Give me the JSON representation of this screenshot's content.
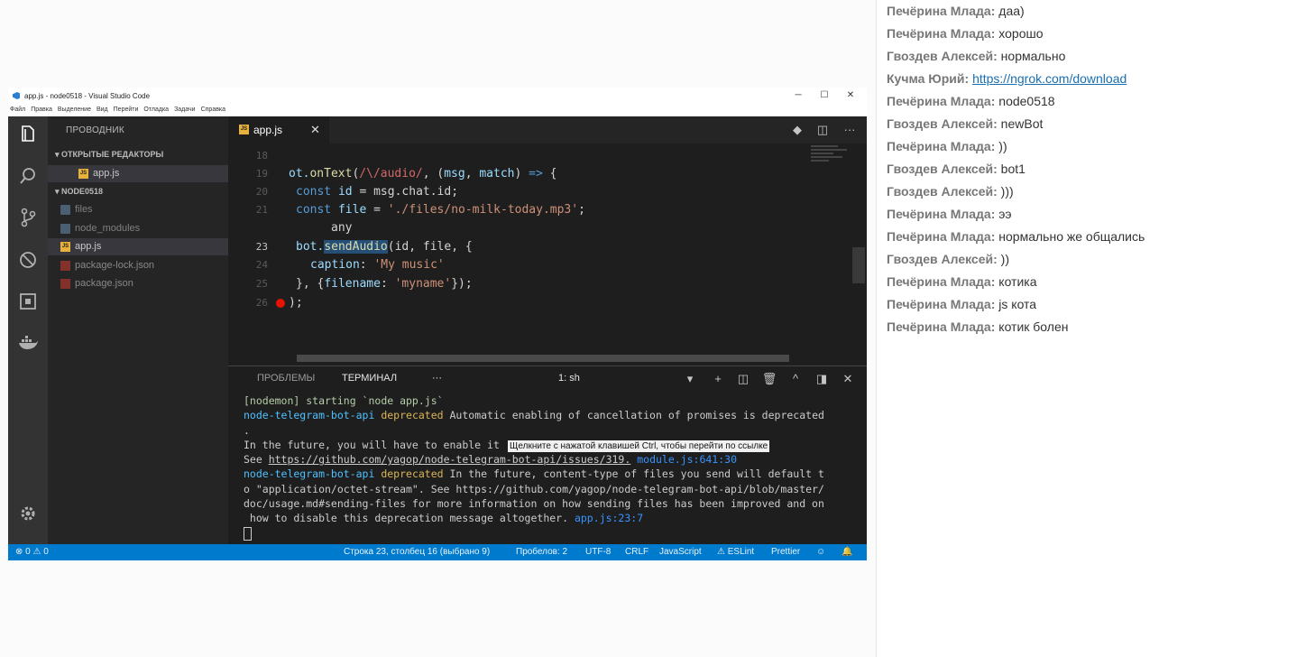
{
  "window": {
    "title": "app.js - node0518 - Visual Studio Code",
    "minimize": "─",
    "maximize": "☐",
    "close": "✕"
  },
  "menu": [
    "Файл",
    "Правка",
    "Выделение",
    "Вид",
    "Перейти",
    "Отладка",
    "Задачи",
    "Справка"
  ],
  "sidebar": {
    "title": "ПРОВОДНИК",
    "open_editors": "ОТКРЫТЫЕ РЕДАКТОРЫ",
    "open_file": "app.js",
    "project": "NODE0518",
    "items": [
      {
        "label": "files",
        "type": "folder"
      },
      {
        "label": "node_modules",
        "type": "folder"
      },
      {
        "label": "app.js",
        "type": "js"
      },
      {
        "label": "package-lock.json",
        "type": "json"
      },
      {
        "label": "package.json",
        "type": "json"
      }
    ]
  },
  "tab": {
    "label": "app.js",
    "close": "✕"
  },
  "editor": {
    "line_numbers": [
      "18",
      "19",
      "20",
      "21",
      "",
      "23",
      "24",
      "25",
      "26"
    ],
    "code": {
      "l19a": "ot.",
      "l19b": "onText",
      "l19c": "(",
      "l19d": "/\\/audio/",
      "l19e": ", (",
      "l19f": "msg",
      "l19g": ", ",
      "l19h": "match",
      "l19i": ") ",
      "l19j": "=>",
      "l19k": " {",
      "l20a": "const",
      "l20b": " id ",
      "l20c": "= msg.chat.id;",
      "l21a": "const",
      "l21b": " file ",
      "l21c": "= ",
      "l21d": "'./files/no-milk-today.mp3'",
      "l21e": ";",
      "hint": "any",
      "l23a": "bot.",
      "l23b": "send",
      "l23c": "Audio",
      "l23d": "(id, file, {",
      "l24a": "caption",
      "l24b": ": ",
      "l24c": "'My music'",
      "l25a": "}, {",
      "l25b": "filename",
      "l25c": ": ",
      "l25d": "'myname'",
      "l25e": "});",
      "l26": ");"
    }
  },
  "panel": {
    "tabs": [
      "ПРОБЛЕМЫ",
      "ТЕРМИНАЛ"
    ],
    "more": "···",
    "terminal_select": "1: sh",
    "lines": {
      "l1": "[nodemon] starting `node app.js`",
      "l2a": "node-telegram-bot-api ",
      "l2b": "deprecated",
      "l2c": " Automatic enabling of cancellation of promises is deprecated",
      "l3": ".",
      "l4": "In the future, you will have to enable it",
      "l5a": "See ",
      "l5b": "https://github.com/yagop/node-telegram-bot-api/issues/319.",
      "l5c": " ",
      "l5d": "module.js:641:30",
      "l6a": "node-telegram-bot-api ",
      "l6b": "deprecated",
      "l6c": " In the future, content-type of files you send will default t",
      "l7": "o \"application/octet-stream\". See https://github.com/yagop/node-telegram-bot-api/blob/master/",
      "l8": "doc/usage.md#sending-files for more information on how sending files has been improved and on",
      "l9a": " how to disable this deprecation message altogether. ",
      "l9b": "app.js:23:7"
    },
    "tooltip": "Щелкните с нажатой клавишей Ctrl, чтобы перейти по ссылке"
  },
  "status": {
    "errors": "⊗ 0  ⚠ 0",
    "position": "Строка 23, столбец 16 (выбрано 9)",
    "spaces": "Пробелов: 2",
    "encoding": "UTF-8",
    "eol": "CRLF",
    "language": "JavaScript",
    "eslint": "ESLint",
    "prettier": "Prettier"
  },
  "chat": [
    {
      "author": "Печёрина Млада:",
      "text": "даа)"
    },
    {
      "author": "Печёрина Млада:",
      "text": "хорошо"
    },
    {
      "author": "Гвоздев Алексей:",
      "text": "нормально"
    },
    {
      "author": "Кучма Юрий:",
      "text": "https://ngrok.com/download",
      "link": true
    },
    {
      "author": "Печёрина Млада:",
      "text": "node0518"
    },
    {
      "author": "Гвоздев Алексей:",
      "text": "newBot"
    },
    {
      "author": "Печёрина Млада:",
      "text": "))"
    },
    {
      "author": "Гвоздев Алексей:",
      "text": "bot1"
    },
    {
      "author": "Гвоздев Алексей:",
      "text": ")))"
    },
    {
      "author": "Печёрина Млада:",
      "text": "ээ"
    },
    {
      "author": "Печёрина Млада:",
      "text": "нормально же общались"
    },
    {
      "author": "Гвоздев Алексей:",
      "text": "))"
    },
    {
      "author": "Печёрина Млада:",
      "text": "котика"
    },
    {
      "author": "Печёрина Млада:",
      "text": "js кота"
    },
    {
      "author": "Печёрина Млада:",
      "text": "котик болен"
    }
  ],
  "colors": {
    "accent": "#007acc",
    "editor_bg": "#1e1e1e",
    "link": "#1a6fb0"
  }
}
